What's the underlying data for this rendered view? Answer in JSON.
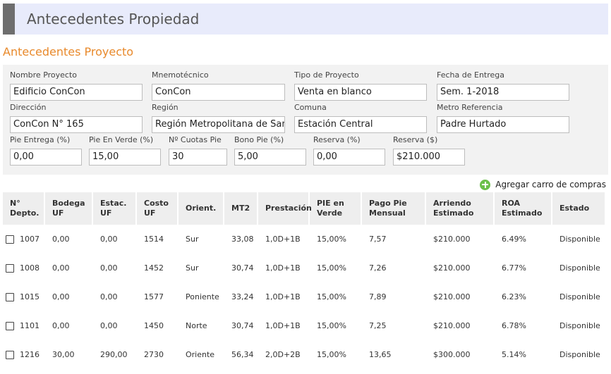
{
  "header": {
    "title": "Antecedentes Propiedad"
  },
  "section": {
    "title": "Antecedentes Proyecto"
  },
  "form": {
    "nombre_proyecto": {
      "label": "Nombre Proyecto",
      "value": "Edificio ConCon"
    },
    "mnemotecnico": {
      "label": "Mnemotécnico",
      "value": "ConCon"
    },
    "tipo_proyecto": {
      "label": "Tipo de Proyecto",
      "value": "Venta en blanco"
    },
    "fecha_entrega": {
      "label": "Fecha de Entrega",
      "value": "Sem. 1-2018"
    },
    "direccion": {
      "label": "Dirección",
      "value": "ConCon N° 165"
    },
    "region": {
      "label": "Región",
      "value": "Región Metropolitana de Santia"
    },
    "comuna": {
      "label": "Comuna",
      "value": "Estación Central"
    },
    "metro_referencia": {
      "label": "Metro Referencia",
      "value": "Padre Hurtado"
    },
    "pie_entrega": {
      "label": "Pie Entrega (%)",
      "value": "0,00"
    },
    "pie_en_verde": {
      "label": "Pie En Verde (%)",
      "value": "15,00"
    },
    "cuotas_pie": {
      "label": "Nº Cuotas Pie",
      "value": "30"
    },
    "bono_pie": {
      "label": "Bono Pie (%)",
      "value": "5,00"
    },
    "reserva_pct": {
      "label": "Reserva (%)",
      "value": "0,00"
    },
    "reserva_monto": {
      "label": "Reserva ($)",
      "value": "$210.000"
    }
  },
  "actions": {
    "add_cart_label": "Agregar carro de compras",
    "add_cart_icon": "plus-circle-icon",
    "add_cart_color": "#6cc04a"
  },
  "table": {
    "headers": [
      [
        "N°",
        "Depto."
      ],
      [
        "Bodega",
        "UF"
      ],
      [
        "Estac.",
        "UF"
      ],
      [
        "Costo",
        "UF"
      ],
      [
        "Orient.",
        ""
      ],
      [
        "MT2",
        ""
      ],
      [
        "Prestación",
        ""
      ],
      [
        "PIE en",
        "Verde"
      ],
      [
        "Pago Pie",
        "Mensual"
      ],
      [
        "Arriendo",
        "Estimado"
      ],
      [
        "ROA",
        "Estimado"
      ],
      [
        "Estado",
        ""
      ]
    ],
    "rows": [
      [
        "1007",
        "0,00",
        "0,00",
        "1514",
        "Sur",
        "33,08",
        "1,0D+1B",
        "15,00%",
        "7,57",
        "$210.000",
        "6.49%",
        "Disponible"
      ],
      [
        "1008",
        "0,00",
        "0,00",
        "1452",
        "Sur",
        "30,74",
        "1,0D+1B",
        "15,00%",
        "7,26",
        "$210.000",
        "6.77%",
        "Disponible"
      ],
      [
        "1015",
        "0,00",
        "0,00",
        "1577",
        "Poniente",
        "33,24",
        "1,0D+1B",
        "15,00%",
        "7,89",
        "$210.000",
        "6.23%",
        "Disponible"
      ],
      [
        "1101",
        "0,00",
        "0,00",
        "1450",
        "Norte",
        "30,74",
        "1,0D+1B",
        "15,00%",
        "7,25",
        "$210.000",
        "6.78%",
        "Disponible"
      ],
      [
        "1216",
        "30,00",
        "290,00",
        "2730",
        "Oriente",
        "56,34",
        "2,0D+2B",
        "15,00%",
        "13,65",
        "$300.000",
        "5.14%",
        "Disponible"
      ]
    ]
  }
}
